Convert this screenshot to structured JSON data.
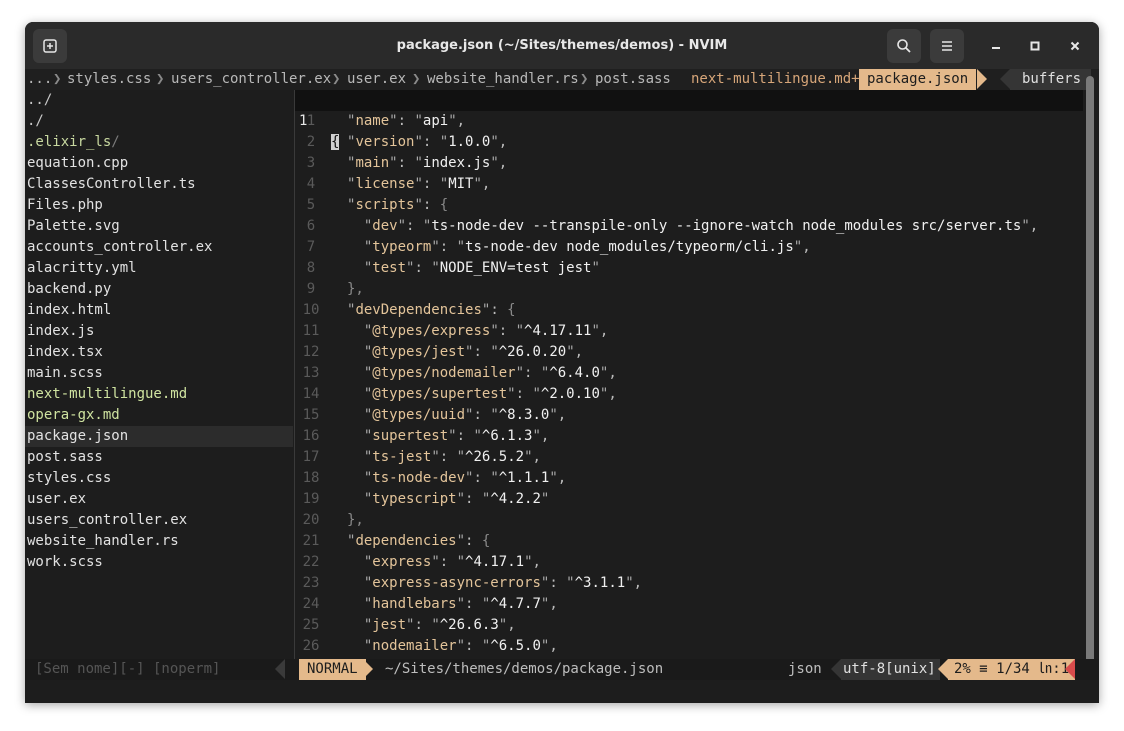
{
  "titlebar": {
    "title": "package.json (~/Sites/themes/demos) - NVIM",
    "new_tab_icon": "new-tab-icon",
    "search_icon": "search-icon",
    "menu_icon": "hamburger-menu-icon",
    "minimize_icon": "minimize-icon",
    "maximize_icon": "maximize-icon",
    "close_icon": "close-icon"
  },
  "tabline": {
    "ellipsis": "...",
    "tabs": [
      "styles.css",
      "users_controller.ex",
      "user.ex",
      "website_handler.rs",
      "post.sass",
      "next-multilingue.md+"
    ],
    "active_tab": "package.json",
    "buffers_label": "buffers",
    "separator": "❯"
  },
  "tree": {
    "entries": [
      {
        "name": "../",
        "type": "dir"
      },
      {
        "name": "./",
        "type": "dir"
      },
      {
        "name": ".elixir_ls",
        "slash": "/",
        "type": "dotdir"
      },
      {
        "name": "equation.cpp"
      },
      {
        "name": "ClassesController.ts"
      },
      {
        "name": "Files.php"
      },
      {
        "name": "Palette.svg"
      },
      {
        "name": "accounts_controller.ex"
      },
      {
        "name": "alacritty.yml"
      },
      {
        "name": "backend.py"
      },
      {
        "name": "index.html"
      },
      {
        "name": "index.js"
      },
      {
        "name": "index.tsx"
      },
      {
        "name": "main.scss"
      },
      {
        "name": "next-multilingue.md"
      },
      {
        "name": "opera-gx.md"
      },
      {
        "name": "package.json",
        "selected": true
      },
      {
        "name": "post.sass"
      },
      {
        "name": "styles.css"
      },
      {
        "name": "user.ex"
      },
      {
        "name": "users_controller.ex"
      },
      {
        "name": "website_handler.rs"
      },
      {
        "name": "work.scss"
      }
    ]
  },
  "editor": {
    "current_line_number": "1",
    "lines": [
      {
        "n": "1",
        "indent": 2,
        "key": "name",
        "val": "api",
        "tail": ","
      },
      {
        "n": "2",
        "indent": 2,
        "key": "version",
        "val": "1.0.0",
        "tail": ","
      },
      {
        "n": "3",
        "indent": 2,
        "key": "main",
        "val": "index.js",
        "tail": ","
      },
      {
        "n": "4",
        "indent": 2,
        "key": "license",
        "val": "MIT",
        "tail": ","
      },
      {
        "n": "5",
        "indent": 2,
        "key": "scripts",
        "open": "{"
      },
      {
        "n": "6",
        "indent": 4,
        "key": "dev",
        "val": "ts-node-dev --transpile-only --ignore-watch node_modules src/server.ts",
        "tail": ","
      },
      {
        "n": "7",
        "indent": 4,
        "key": "typeorm",
        "val": "ts-node-dev node_modules/typeorm/cli.js",
        "tail": ","
      },
      {
        "n": "8",
        "indent": 4,
        "key": "test",
        "val": "NODE_ENV=test jest",
        "tail": ""
      },
      {
        "n": "9",
        "indent": 2,
        "close": "},"
      },
      {
        "n": "10",
        "indent": 2,
        "key": "devDependencies",
        "open": "{"
      },
      {
        "n": "11",
        "indent": 4,
        "key": "@types/express",
        "val": "^4.17.11",
        "tail": ","
      },
      {
        "n": "12",
        "indent": 4,
        "key": "@types/jest",
        "val": "^26.0.20",
        "tail": ","
      },
      {
        "n": "13",
        "indent": 4,
        "key": "@types/nodemailer",
        "val": "^6.4.0",
        "tail": ","
      },
      {
        "n": "14",
        "indent": 4,
        "key": "@types/supertest",
        "val": "^2.0.10",
        "tail": ","
      },
      {
        "n": "15",
        "indent": 4,
        "key": "@types/uuid",
        "val": "^8.3.0",
        "tail": ","
      },
      {
        "n": "16",
        "indent": 4,
        "key": "supertest",
        "val": "^6.1.3",
        "tail": ","
      },
      {
        "n": "17",
        "indent": 4,
        "key": "ts-jest",
        "val": "^26.5.2",
        "tail": ","
      },
      {
        "n": "18",
        "indent": 4,
        "key": "ts-node-dev",
        "val": "^1.1.1",
        "tail": ","
      },
      {
        "n": "19",
        "indent": 4,
        "key": "typescript",
        "val": "^4.2.2",
        "tail": ""
      },
      {
        "n": "20",
        "indent": 2,
        "close": "},"
      },
      {
        "n": "21",
        "indent": 2,
        "key": "dependencies",
        "open": "{"
      },
      {
        "n": "22",
        "indent": 4,
        "key": "express",
        "val": "^4.17.1",
        "tail": ","
      },
      {
        "n": "23",
        "indent": 4,
        "key": "express-async-errors",
        "val": "^3.1.1",
        "tail": ","
      },
      {
        "n": "24",
        "indent": 4,
        "key": "handlebars",
        "val": "^4.7.7",
        "tail": ","
      },
      {
        "n": "25",
        "indent": 4,
        "key": "jest",
        "val": "^26.6.3",
        "tail": ","
      },
      {
        "n": "26",
        "indent": 4,
        "key": "nodemailer",
        "val": "^6.5.0",
        "tail": ","
      }
    ],
    "first_line_text": "{"
  },
  "statusline": {
    "left_inactive": "[Sem nome][-] [noperm]",
    "mode": "NORMAL",
    "file_path": "~/Sites/themes/demos/package.json",
    "filetype": "json",
    "encoding": "utf-8[unix]",
    "position": "2% ≡ 1/34 ㏑:1"
  },
  "colors": {
    "accent": "#e4b98b",
    "background": "#1d1d1d",
    "warning": "#d84b4b"
  }
}
